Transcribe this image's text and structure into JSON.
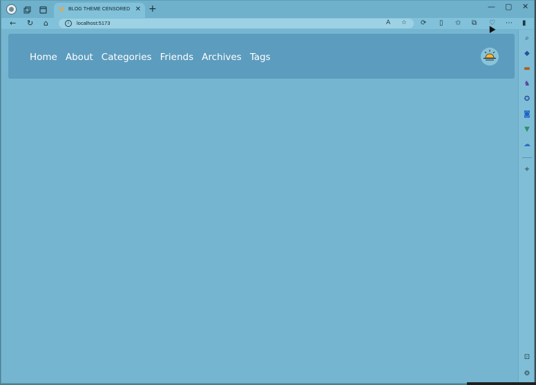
{
  "browser": {
    "tab": {
      "favicon_glyph": "V",
      "title": "BLOG THEME CENSORED",
      "close_glyph": "✕"
    },
    "newtab_glyph": "+",
    "window_controls": {
      "minimize": "—",
      "maximize": "▢",
      "close": "✕"
    },
    "address": {
      "url": "localhost:5173"
    }
  },
  "page": {
    "nav": {
      "items": [
        "Home",
        "About",
        "Categories",
        "Friends",
        "Archives",
        "Tags"
      ]
    },
    "theme_toggle_icon": "sunrise-icon"
  },
  "colors": {
    "page_bg": "#75b5d0",
    "navbar_bg": "#5c9cbe",
    "nav_text": "#ffffff",
    "sun": "#f5b83a"
  }
}
